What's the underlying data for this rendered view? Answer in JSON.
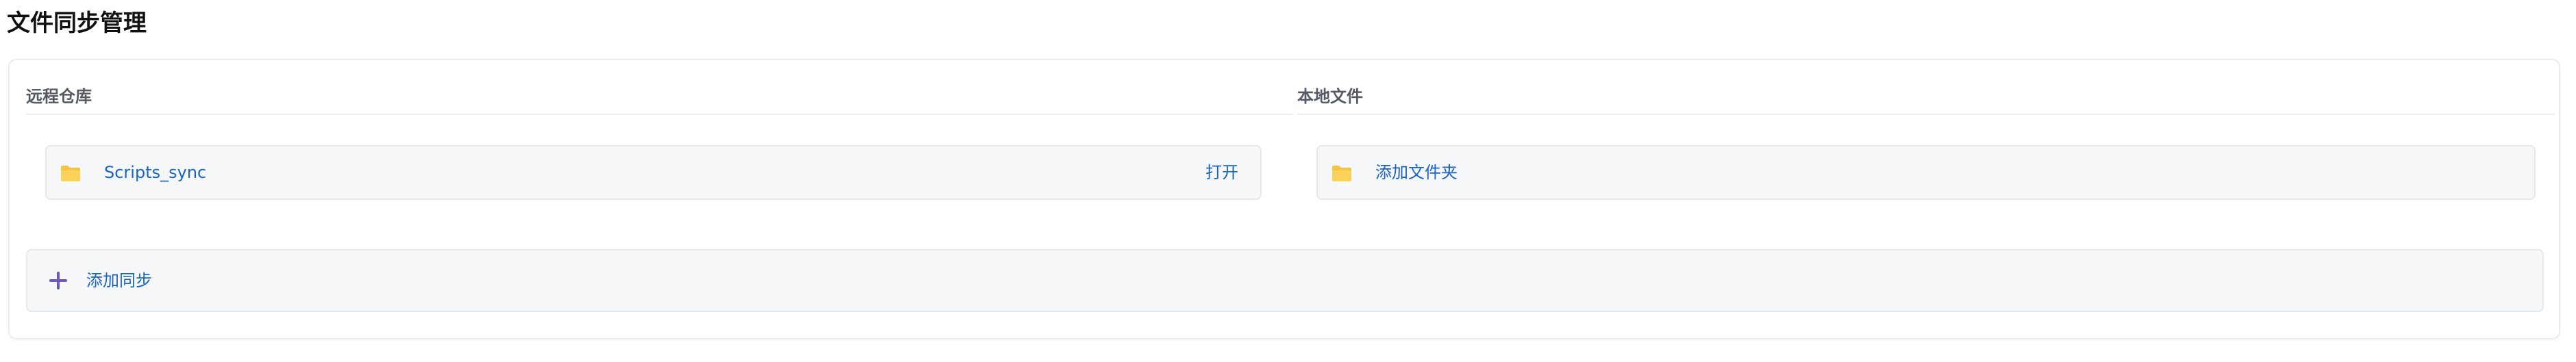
{
  "page": {
    "title": "文件同步管理"
  },
  "columns": {
    "remote_header": "远程仓库",
    "local_header": "本地文件"
  },
  "remote_item": {
    "icon": "folder-icon",
    "name": "Scripts_sync",
    "action_label": "打开"
  },
  "local_item": {
    "icon": "folder-icon",
    "label": "添加文件夹"
  },
  "add_sync": {
    "icon": "plus-icon",
    "label": "添加同步"
  },
  "colors": {
    "link": "#1a63c7",
    "folder": "#f6c343",
    "plus": "#6e55c2",
    "card_bg": "#f6f7f9"
  }
}
